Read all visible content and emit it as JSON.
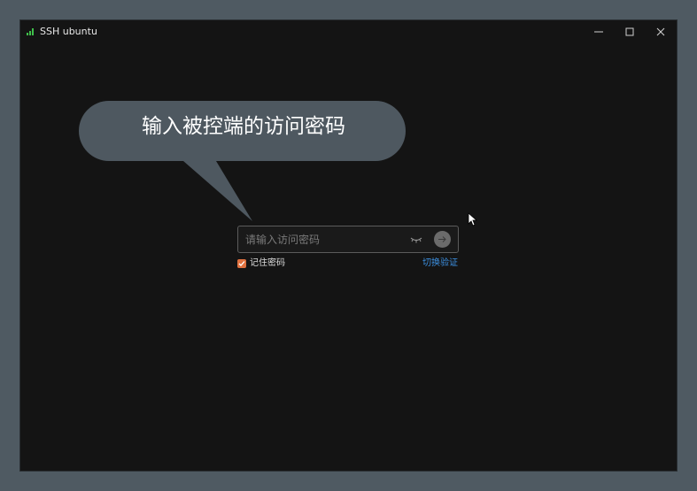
{
  "window": {
    "title": "SSH ubuntu",
    "signal_icon": "signal-strength-icon",
    "controls": [
      "minimize-icon",
      "maximize-icon",
      "close-icon"
    ]
  },
  "callout": {
    "text": "输入被控端的访问密码"
  },
  "login": {
    "password_placeholder": "请输入访问密码",
    "password_value": "",
    "show_password_icon": "eye-closed-icon",
    "submit_icon": "arrow-right-icon",
    "remember_label": "记住密码",
    "remember_checked": true,
    "switch_auth_label": "切换验证"
  },
  "colors": {
    "accent": "#e0713f",
    "link": "#3c8fe0",
    "window_bg": "#141414",
    "desktop_bg": "#4f5a62",
    "callout_bg": "#4e5860"
  }
}
